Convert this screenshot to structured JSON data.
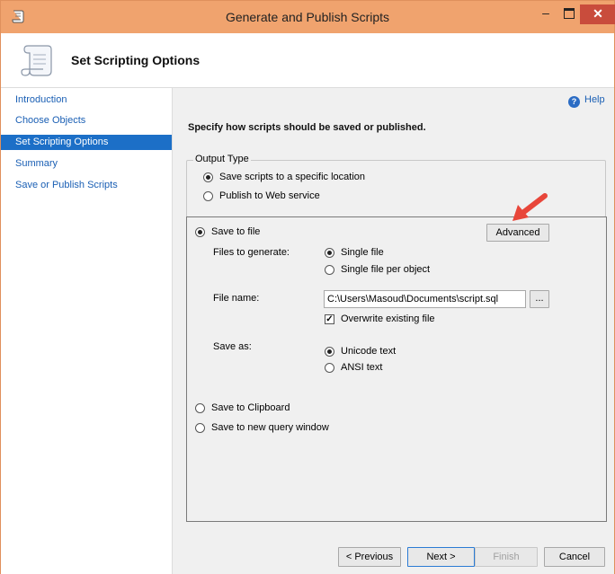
{
  "window": {
    "title": "Generate and Publish Scripts"
  },
  "header": {
    "title": "Set Scripting Options"
  },
  "sidebar": {
    "items": [
      {
        "label": "Introduction"
      },
      {
        "label": "Choose Objects"
      },
      {
        "label": "Set Scripting Options"
      },
      {
        "label": "Summary"
      },
      {
        "label": "Save or Publish Scripts"
      }
    ],
    "selected_index": 2
  },
  "help": {
    "label": "Help"
  },
  "main": {
    "subtitle": "Specify how scripts should be saved or published."
  },
  "output_type": {
    "legend": "Output Type",
    "options": [
      "Save scripts to a specific location",
      "Publish to Web service"
    ],
    "selected": 0
  },
  "save_to_file": {
    "label": "Save to file",
    "advanced_label": "Advanced",
    "files_to_generate_label": "Files to generate:",
    "files_options": [
      "Single file",
      "Single file per object"
    ],
    "file_name_label": "File name:",
    "file_name_value": "C:\\Users\\Masoud\\Documents\\script.sql",
    "browse_label": "...",
    "overwrite_label": "Overwrite existing file",
    "overwrite_checked": true,
    "save_as_label": "Save as:",
    "save_as_options": [
      "Unicode text",
      "ANSI text"
    ]
  },
  "other_targets": {
    "clipboard_label": "Save to Clipboard",
    "query_window_label": "Save to new query window"
  },
  "footer": {
    "previous": "< Previous",
    "next": "Next >",
    "finish": "Finish",
    "cancel": "Cancel"
  },
  "colors": {
    "titlebar": "#f0a36e",
    "close": "#c94c3c",
    "selection": "#1c6fc7",
    "arrow": "#e8463a"
  }
}
